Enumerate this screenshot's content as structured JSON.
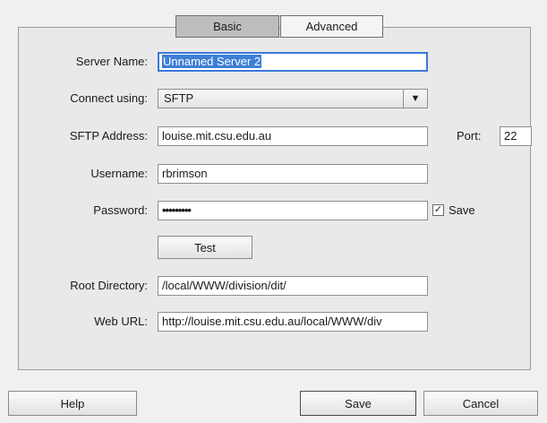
{
  "tabs": {
    "basic": "Basic",
    "advanced": "Advanced"
  },
  "labels": {
    "server_name": "Server Name:",
    "connect_using": "Connect using:",
    "sftp_address": "SFTP Address:",
    "port": "Port:",
    "username": "Username:",
    "password": "Password:",
    "save_password": "Save",
    "root_directory": "Root Directory:",
    "web_url": "Web URL:"
  },
  "values": {
    "server_name": "Unnamed Server 2",
    "connect_using": "SFTP",
    "sftp_address": "louise.mit.csu.edu.au",
    "port": "22",
    "username": "rbrimson",
    "password": "•••••••••",
    "save_password_checked": "✓",
    "root_directory": "/local/WWW/division/dit/",
    "web_url": "http://louise.mit.csu.edu.au/local/WWW/div"
  },
  "buttons": {
    "test": "Test",
    "help": "Help",
    "save": "Save",
    "cancel": "Cancel"
  },
  "icons": {
    "dropdown": "▼"
  },
  "colors": {
    "focus_border": "#3b78d8",
    "selection": "#3e7fd6"
  }
}
